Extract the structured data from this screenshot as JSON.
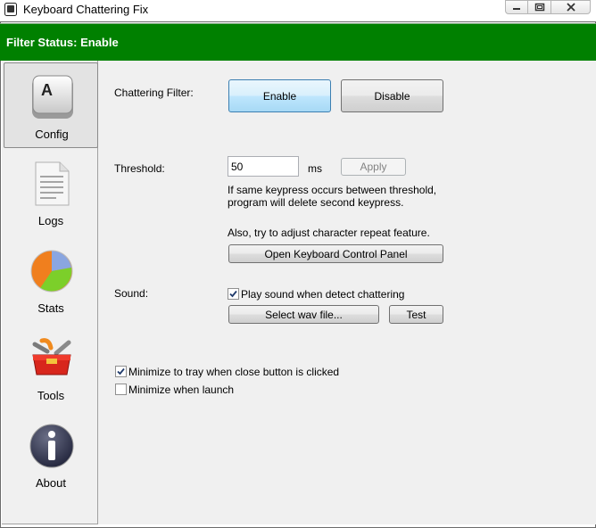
{
  "window": {
    "title": "Keyboard Chattering Fix",
    "icon": "keyboard-app-icon"
  },
  "status": {
    "text": "Filter Status: Enable",
    "color": "#008000"
  },
  "sidebar": {
    "items": [
      {
        "label": "Config",
        "icon": "keyboard-key-icon",
        "selected": true
      },
      {
        "label": "Logs",
        "icon": "document-icon"
      },
      {
        "label": "Stats",
        "icon": "pie-chart-icon"
      },
      {
        "label": "Tools",
        "icon": "toolbox-icon"
      },
      {
        "label": "About",
        "icon": "info-icon"
      }
    ]
  },
  "config": {
    "chattering_label": "Chattering Filter:",
    "enable_label": "Enable",
    "disable_label": "Disable",
    "threshold_label": "Threshold:",
    "threshold_value": "50",
    "threshold_unit": "ms",
    "apply_label": "Apply",
    "threshold_help_1": "If same keypress occurs between threshold,",
    "threshold_help_2": "program will delete second keypress.",
    "repeat_help": "Also, try to adjust character repeat feature.",
    "open_panel_label": "Open Keyboard Control Panel",
    "sound_label": "Sound:",
    "play_sound_label": "Play sound when detect chattering",
    "play_sound_checked": true,
    "select_wav_label": "Select wav file...",
    "test_label": "Test",
    "minimize_tray_label": "Minimize to tray when close button is clicked",
    "minimize_tray_checked": true,
    "minimize_launch_label": "Minimize when launch",
    "minimize_launch_checked": false
  }
}
